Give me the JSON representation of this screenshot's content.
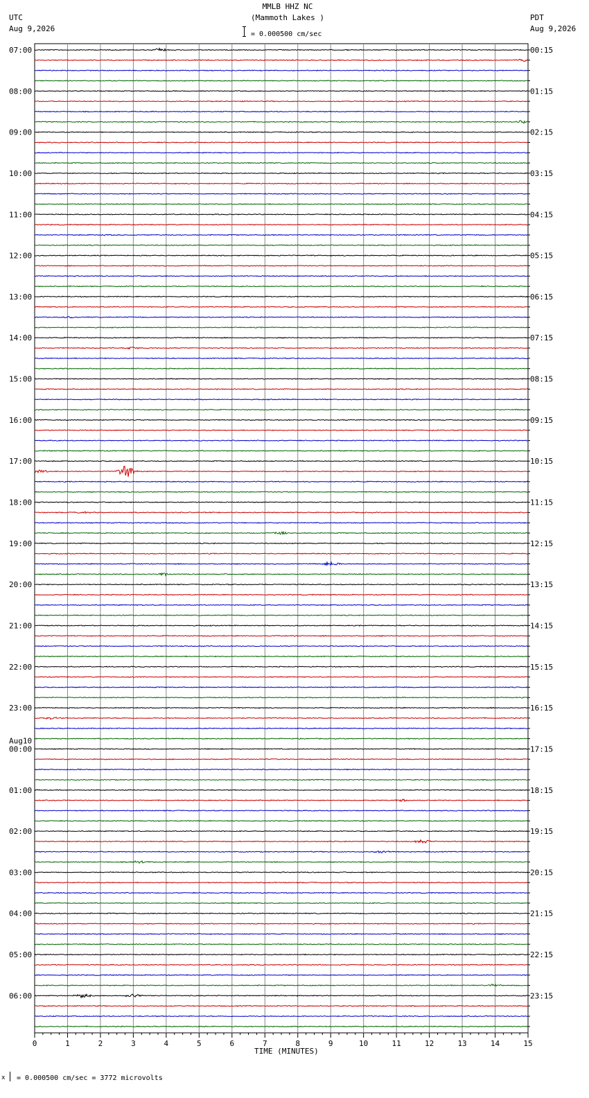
{
  "header": {
    "station": "MMLB HHZ NC",
    "location": "(Mammoth Lakes )",
    "scale_text": "= 0.000500 cm/sec",
    "left_tz": "UTC",
    "left_date": "Aug 9,2026",
    "right_tz": "PDT",
    "right_date": "Aug 9,2026"
  },
  "footer": {
    "prefix": "x",
    "scale_text": "= 0.000500 cm/sec =    3772 microvolts"
  },
  "chart_data": {
    "type": "line",
    "title": "MMLB HHZ NC (Mammoth Lakes )",
    "xlabel": "TIME (MINUTES)",
    "ylabel": "",
    "xlim": [
      0,
      15
    ],
    "x_ticks": [
      "0",
      "1",
      "2",
      "3",
      "4",
      "5",
      "6",
      "7",
      "8",
      "9",
      "10",
      "11",
      "12",
      "13",
      "14",
      "15"
    ],
    "trace_count": 96,
    "trace_colors": [
      "#000000",
      "#cc0000",
      "#0000cc",
      "#006600"
    ],
    "left_hour_labels": [
      {
        "trace": 0,
        "text": "07:00"
      },
      {
        "trace": 4,
        "text": "08:00"
      },
      {
        "trace": 8,
        "text": "09:00"
      },
      {
        "trace": 12,
        "text": "10:00"
      },
      {
        "trace": 16,
        "text": "11:00"
      },
      {
        "trace": 20,
        "text": "12:00"
      },
      {
        "trace": 24,
        "text": "13:00"
      },
      {
        "trace": 28,
        "text": "14:00"
      },
      {
        "trace": 32,
        "text": "15:00"
      },
      {
        "trace": 36,
        "text": "16:00"
      },
      {
        "trace": 40,
        "text": "17:00"
      },
      {
        "trace": 44,
        "text": "18:00"
      },
      {
        "trace": 48,
        "text": "19:00"
      },
      {
        "trace": 52,
        "text": "20:00"
      },
      {
        "trace": 56,
        "text": "21:00"
      },
      {
        "trace": 60,
        "text": "22:00"
      },
      {
        "trace": 64,
        "text": "23:00"
      },
      {
        "trace": 68,
        "text": "00:00",
        "date": "Aug10"
      },
      {
        "trace": 72,
        "text": "01:00"
      },
      {
        "trace": 76,
        "text": "02:00"
      },
      {
        "trace": 80,
        "text": "03:00"
      },
      {
        "trace": 84,
        "text": "04:00"
      },
      {
        "trace": 88,
        "text": "05:00"
      },
      {
        "trace": 92,
        "text": "06:00"
      }
    ],
    "right_hour_labels": [
      {
        "trace": 0,
        "text": "00:15"
      },
      {
        "trace": 4,
        "text": "01:15"
      },
      {
        "trace": 8,
        "text": "02:15"
      },
      {
        "trace": 12,
        "text": "03:15"
      },
      {
        "trace": 16,
        "text": "04:15"
      },
      {
        "trace": 20,
        "text": "05:15"
      },
      {
        "trace": 24,
        "text": "06:15"
      },
      {
        "trace": 28,
        "text": "07:15"
      },
      {
        "trace": 32,
        "text": "08:15"
      },
      {
        "trace": 36,
        "text": "09:15"
      },
      {
        "trace": 40,
        "text": "10:15"
      },
      {
        "trace": 44,
        "text": "11:15"
      },
      {
        "trace": 48,
        "text": "12:15"
      },
      {
        "trace": 52,
        "text": "13:15"
      },
      {
        "trace": 56,
        "text": "14:15"
      },
      {
        "trace": 60,
        "text": "15:15"
      },
      {
        "trace": 64,
        "text": "16:15"
      },
      {
        "trace": 68,
        "text": "17:15"
      },
      {
        "trace": 72,
        "text": "18:15"
      },
      {
        "trace": 76,
        "text": "19:15"
      },
      {
        "trace": 80,
        "text": "20:15"
      },
      {
        "trace": 84,
        "text": "21:15"
      },
      {
        "trace": 88,
        "text": "22:15"
      },
      {
        "trace": 92,
        "text": "23:15"
      }
    ],
    "events": [
      {
        "trace": 0,
        "minute": 3.8,
        "amp": 0.6
      },
      {
        "trace": 1,
        "minute": 14.8,
        "amp": 0.5
      },
      {
        "trace": 7,
        "minute": 14.8,
        "amp": 0.5
      },
      {
        "trace": 18,
        "minute": 2.2,
        "amp": 0.3
      },
      {
        "trace": 26,
        "minute": 1.0,
        "amp": 0.4
      },
      {
        "trace": 29,
        "minute": 3.0,
        "amp": 0.4
      },
      {
        "trace": 41,
        "minute": 2.8,
        "amp": 2.5
      },
      {
        "trace": 41,
        "minute": 0.2,
        "amp": 0.5
      },
      {
        "trace": 45,
        "minute": 1.5,
        "amp": 0.3
      },
      {
        "trace": 47,
        "minute": 7.5,
        "amp": 0.5
      },
      {
        "trace": 50,
        "minute": 9.0,
        "amp": 0.8
      },
      {
        "trace": 51,
        "minute": 3.9,
        "amp": 0.5
      },
      {
        "trace": 65,
        "minute": 0.5,
        "amp": 0.4
      },
      {
        "trace": 73,
        "minute": 11.2,
        "amp": 0.4
      },
      {
        "trace": 77,
        "minute": 11.8,
        "amp": 0.6
      },
      {
        "trace": 78,
        "minute": 10.5,
        "amp": 0.6
      },
      {
        "trace": 79,
        "minute": 3.2,
        "amp": 0.5
      },
      {
        "trace": 91,
        "minute": 14.0,
        "amp": 0.6
      },
      {
        "trace": 92,
        "minute": 1.5,
        "amp": 0.8
      },
      {
        "trace": 92,
        "minute": 3.0,
        "amp": 0.7
      }
    ]
  }
}
